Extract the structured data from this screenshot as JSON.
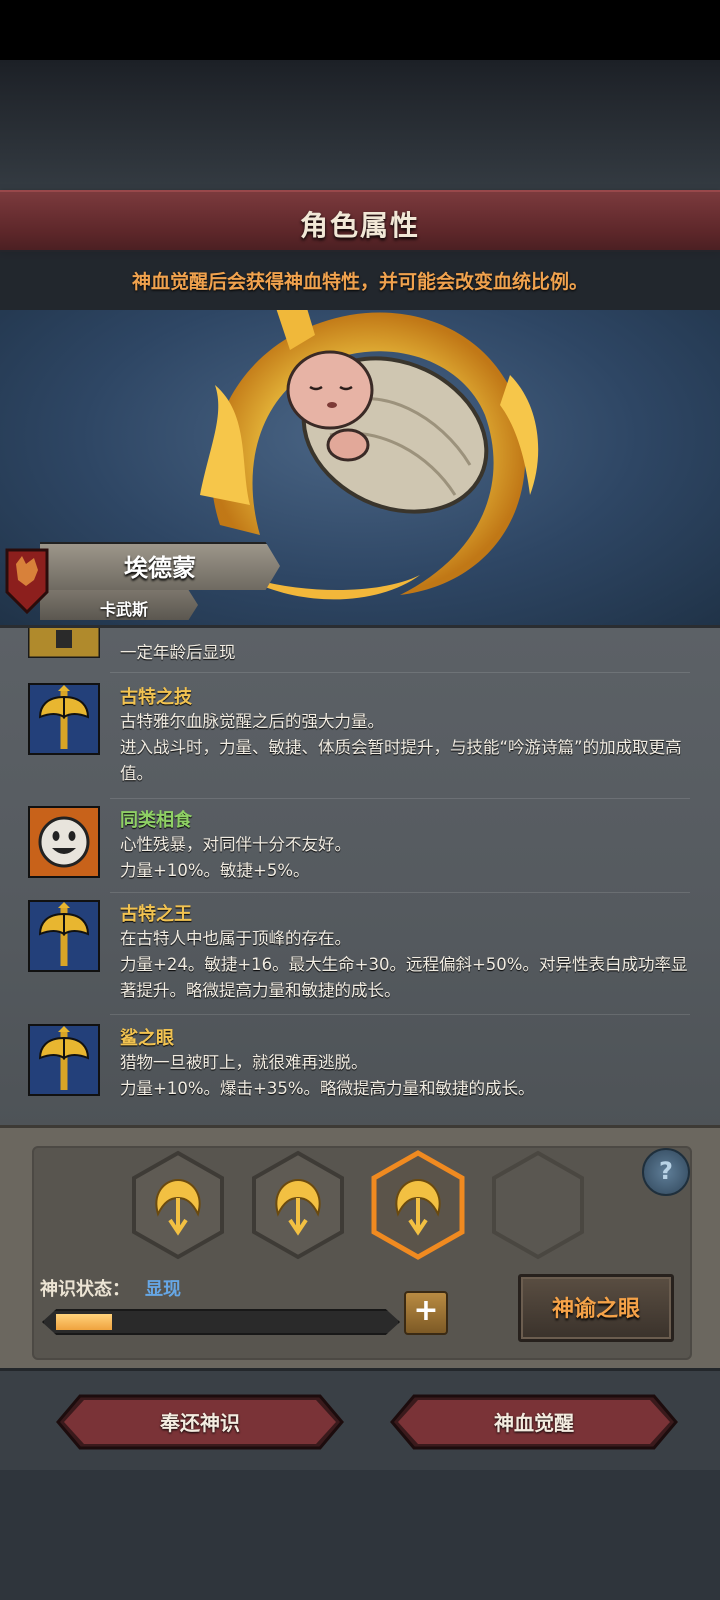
{
  "header": {
    "title": "角色属性"
  },
  "subtitle": "神血觉醒后会获得神血特性，并可能会改变血统比例。",
  "character": {
    "name": "埃德蒙",
    "clan": "卡武斯"
  },
  "traits": [
    {
      "name": "",
      "desc": "一定年龄后显现",
      "icon": "helmet-icon"
    },
    {
      "name": "古特之技",
      "desc": "古特雅尔血脉觉醒之后的强大力量。\n进入战斗时，力量、敏捷、体质会暂时提升，与技能“吟游诗篇”的加成取更高值。",
      "icon": "axe-icon"
    },
    {
      "name": "同类相食",
      "desc": "心性残暴，对同伴十分不友好。\n力量+10%。敏捷+5%。",
      "icon": "smiley-icon"
    },
    {
      "name": "古特之王",
      "desc": "在古特人中也属于顶峰的存在。\n力量+24。敏捷+16。最大生命+30。远程偏斜+50%。对异性表白成功率显著提升。略微提高力量和敏捷的成长。",
      "icon": "axe-icon"
    },
    {
      "name": "鲨之眼",
      "desc": "猎物一旦被盯上，就很难再逃脱。\n力量+10%。爆击+35%。略微提高力量和敏捷的成长。",
      "icon": "axe-icon"
    }
  ],
  "slots": [
    "filled",
    "filled",
    "selected",
    "empty"
  ],
  "status": {
    "label": "神识状态：",
    "value": "显现",
    "progress": 0.17
  },
  "help_label": "?",
  "plus_label": "+",
  "oracle_button": "神谕之眼",
  "buttons": {
    "return": "奉还神识",
    "awaken": "神血觉醒"
  },
  "colors": {
    "accent_orange": "#f0a24e",
    "header_red": "#5c2629",
    "status_blue": "#66a7e6"
  }
}
